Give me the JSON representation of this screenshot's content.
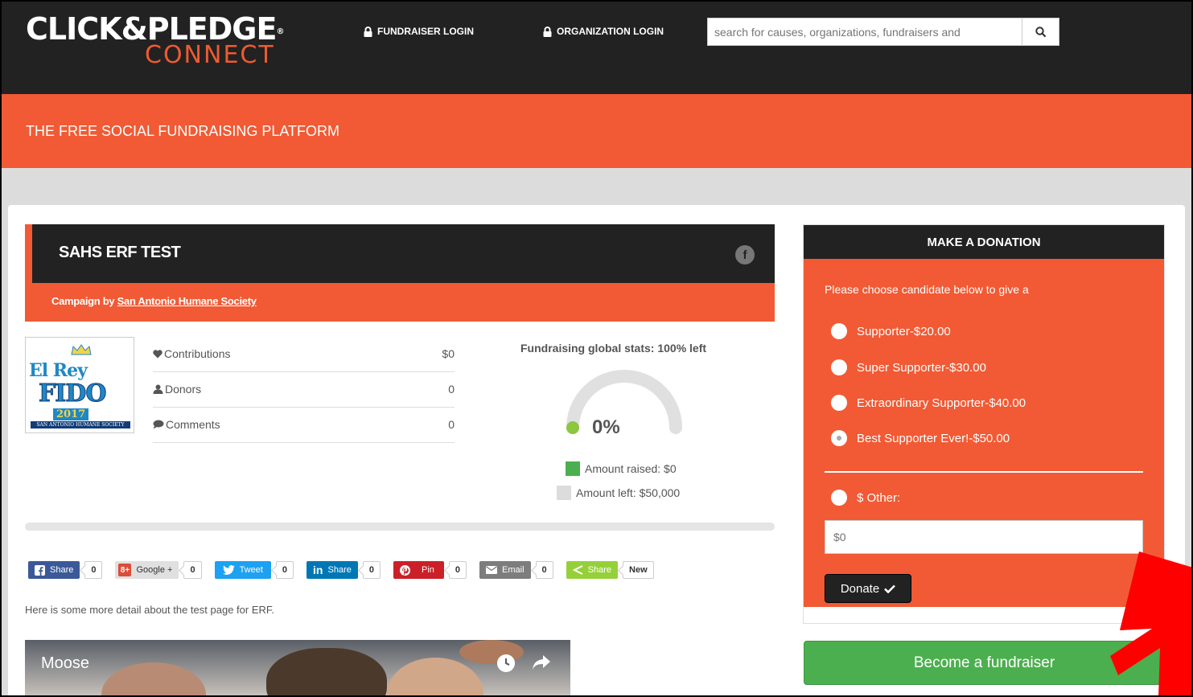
{
  "header": {
    "logo_top": "CLICK&PLEDGE",
    "logo_bottom": "CONNECT",
    "fundraiser_login": "FUNDRAISER LOGIN",
    "organization_login": "ORGANIZATION LOGIN",
    "search_placeholder": "search for causes, organizations, fundraisers and"
  },
  "tagline": "THE FREE SOCIAL FUNDRAISING PLATFORM",
  "campaign": {
    "title": "SAHS ERF TEST",
    "by_label": "Campaign by ",
    "by_org": "San Antonio Humane Society",
    "facebook_icon": "f",
    "logo": {
      "line1": "El Rey",
      "line2": "FIDO",
      "line3": "2017",
      "line4": "SAN ANTONIO HUMANE SOCIETY"
    },
    "stats": [
      {
        "label": "Contributions",
        "value": "$0",
        "icon": "heart-icon"
      },
      {
        "label": "Donors",
        "value": "0",
        "icon": "user-icon"
      },
      {
        "label": "Comments",
        "value": "0",
        "icon": "comment-icon"
      }
    ],
    "gauge_title": "Fundraising global stats: 100% left",
    "gauge_percent": "0%",
    "gauge_fraction": 0,
    "amount_raised": "Amount raised: $0",
    "amount_left": "Amount left: $50,000",
    "detail": "Here is some more detail about the test page for ERF."
  },
  "share": [
    {
      "label": "Share",
      "count": "0",
      "color": "#3b5998",
      "icon": "facebook-icon"
    },
    {
      "label": "Google +",
      "count": "0",
      "color": "#e0e0e0",
      "icon": "google-plus-icon"
    },
    {
      "label": "Tweet",
      "count": "0",
      "color": "#1da1f2",
      "icon": "twitter-icon"
    },
    {
      "label": "Share",
      "count": "0",
      "color": "#0077b5",
      "icon": "linkedin-icon"
    },
    {
      "label": "Pin",
      "count": "0",
      "color": "#cb2027",
      "icon": "pinterest-icon"
    },
    {
      "label": "Email",
      "count": "0",
      "color": "#7d7d7d",
      "icon": "email-icon"
    },
    {
      "label": "Share",
      "count": "New",
      "color": "#95d03a",
      "icon": "share-icon"
    }
  ],
  "video": {
    "title": "Moose"
  },
  "donation": {
    "heading": "MAKE A DONATION",
    "intro": "Please choose candidate below to give a",
    "options": [
      {
        "label": "Supporter-$20.00",
        "checked": false
      },
      {
        "label": "Super Supporter-$30.00",
        "checked": false
      },
      {
        "label": "Extraordinary Supporter-$40.00",
        "checked": false
      },
      {
        "label": "Best Supporter Ever!-$50.00",
        "checked": true
      }
    ],
    "other_label": "$ Other:",
    "other_placeholder": "$0",
    "donate_label": "Donate",
    "become_label": "Become a fundraiser"
  },
  "colors": {
    "brand": "#f15a34",
    "dark": "#222222",
    "green": "#4caf4f",
    "annotation": "#ff0000"
  }
}
